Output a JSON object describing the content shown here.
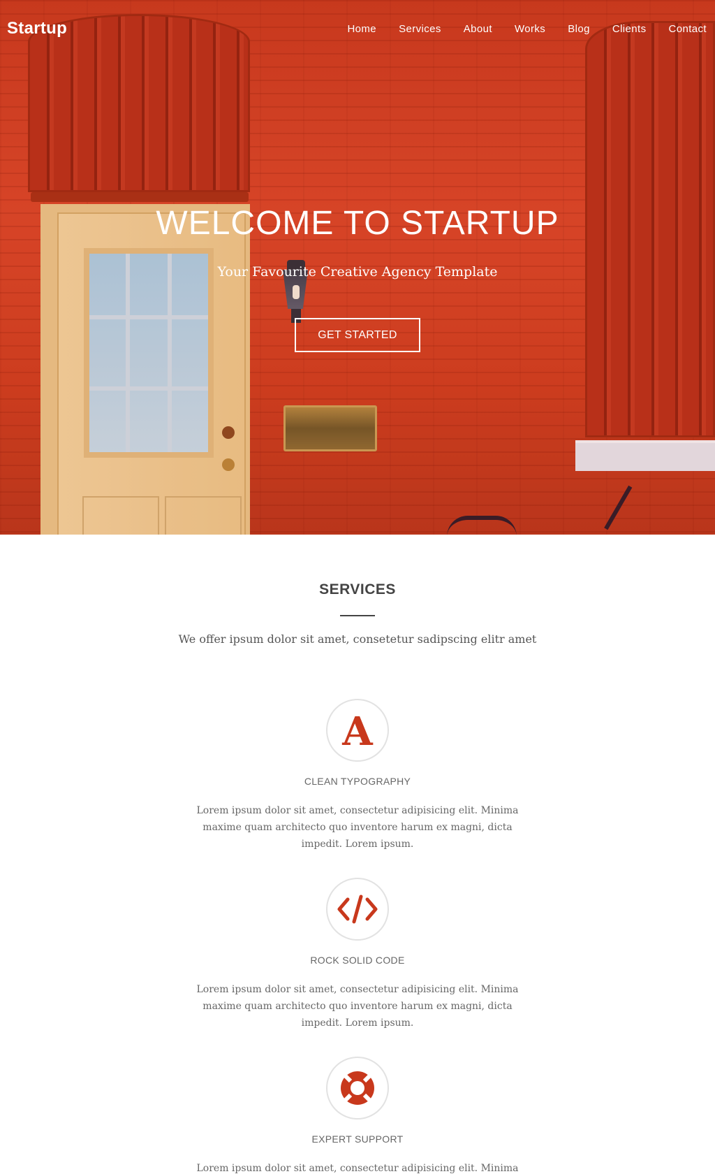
{
  "brand": "Startup",
  "nav": {
    "items": [
      "Home",
      "Services",
      "About",
      "Works",
      "Blog",
      "Clients",
      "Contact"
    ]
  },
  "hero": {
    "title": "WELCOME TO STARTUP",
    "subtitle": "Your Favourite Creative Agency Template",
    "cta_label": "GET STARTED"
  },
  "services": {
    "title": "SERVICES",
    "intro": "We offer ipsum dolor sit amet, consetetur sadipscing elitr amet",
    "items": [
      {
        "icon": "typography-icon",
        "title": "CLEAN TYPOGRAPHY",
        "text": "Lorem ipsum dolor sit amet, consectetur adipisicing elit. Minima maxime quam architecto quo inventore harum ex magni, dicta impedit. Lorem ipsum."
      },
      {
        "icon": "code-icon",
        "title": "ROCK SOLID CODE",
        "text": "Lorem ipsum dolor sit amet, consectetur adipisicing elit. Minima maxime quam architecto quo inventore harum ex magni, dicta impedit. Lorem ipsum."
      },
      {
        "icon": "lifebuoy-icon",
        "title": "EXPERT SUPPORT",
        "text": "Lorem ipsum dolor sit amet, consectetur adipisicing elit. Minima maxime"
      }
    ]
  },
  "colors": {
    "accent": "#c8381c",
    "hero_base": "#d9472a",
    "text": "#555555"
  }
}
